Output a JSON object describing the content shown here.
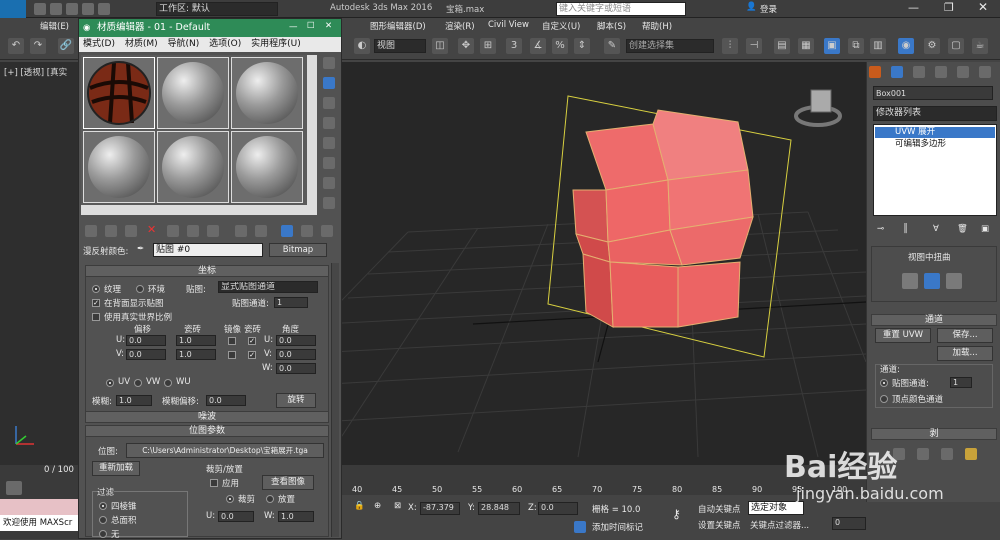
{
  "app": {
    "window_title": "Autodesk 3ds Max 2016",
    "file_name": "宝箱.max",
    "workspace": "工作区: 默认",
    "search_placeholder": "键入关键字或短语",
    "login": "登录",
    "logo_text": "MAX"
  },
  "menubar": {
    "items": [
      "编辑(E)",
      "图形编辑器(D)",
      "渲染(R)",
      "Civil View",
      "自定义(U)",
      "脚本(S)",
      "帮助(H)"
    ]
  },
  "toolbar": {
    "view_combo": "视图",
    "selection_set": "创建选择集",
    "numbers": [
      "3",
      "%"
    ]
  },
  "viewport": {
    "label": "[+] [透视] [真实",
    "timeline": "0 / 100",
    "gizmo_axes": [
      "x",
      "y",
      "z"
    ]
  },
  "material_editor": {
    "title": "材质编辑器 - 01 - Default",
    "menu": [
      "模式(D)",
      "材质(M)",
      "导航(N)",
      "选项(O)",
      "实用程序(U)"
    ],
    "diffuse_label": "漫反射颜色:",
    "map_name": "贴图 #0",
    "map_type": "Bitmap",
    "coords": {
      "header": "坐标",
      "texture": "纹理",
      "environ": "环境",
      "mapping_label": "贴图:",
      "mapping_value": "显式贴图通道",
      "show_back": "在背面显示贴图",
      "channel_label": "贴图通道:",
      "channel_value": "1",
      "real_world": "使用真实世界比例",
      "col_offset": "偏移",
      "col_tiling": "瓷砖",
      "col_mirror": "镜像",
      "col_tile": "瓷砖",
      "col_angle": "角度",
      "u": "U:",
      "v": "V:",
      "w": "W:",
      "u_offset": "0.0",
      "v_offset": "0.0",
      "u_tiling": "1.0",
      "v_tiling": "1.0",
      "u_angle": "0.0",
      "v_angle": "0.0",
      "w_angle": "0.0",
      "uv": "UV",
      "vw": "VW",
      "wu": "WU",
      "blur_label": "模糊:",
      "blur_value": "1.0",
      "blur_offset_label": "模糊偏移:",
      "blur_offset_value": "0.0",
      "rotate": "旋转"
    },
    "noise_header": "噪波",
    "bitmap_params": {
      "header": "位图参数",
      "bitmap_label": "位图:",
      "bitmap_path": "C:\\Users\\Administrator\\Desktop\\宝箱展开.tga",
      "reload": "重新加载",
      "crop_group": "裁剪/放置",
      "apply": "应用",
      "view_image": "查看图像",
      "crop": "裁剪",
      "place": "放置",
      "u_label": "U:",
      "u_value": "0.0",
      "w_label": "W:",
      "w_value": "1.0",
      "filter_group": "过滤",
      "quad": "四棱锥",
      "summed": "总面积",
      "none": "无"
    }
  },
  "command_panel": {
    "object_name": "Box001",
    "modifier_list": "修改器列表",
    "stack": [
      "UVW 展开",
      "可编辑多边形"
    ],
    "peel_header": "视图中扭曲",
    "channel_header": "通道",
    "reset_uvw": "重置 UVW",
    "save": "保存...",
    "load": "加载...",
    "channel_group": "通道:",
    "map_channel_label": "贴图通道:",
    "map_channel_value": "1",
    "vertex_color": "顶点颜色通道",
    "peel_label": "剥"
  },
  "status": {
    "welcome": "欢迎使用 MAXScr",
    "x_label": "X:",
    "x_value": "-87.379",
    "y_label": "Y:",
    "y_value": "28.848",
    "z_label": "Z:",
    "z_value": "0.0",
    "grid": "栅格 = 10.0",
    "auto_key": "自动关键点",
    "selected": "选定对象",
    "set_key": "设置关键点",
    "key_filters": "关键点过滤器...",
    "add_time_tag": "添加时间标记",
    "frame_value": "0",
    "ruler_ticks": [
      "40",
      "45",
      "50",
      "55",
      "60",
      "65",
      "70",
      "75",
      "80",
      "85",
      "90",
      "95",
      "100"
    ]
  },
  "watermark": {
    "text": "Bai经验",
    "sub": "jingyan.baidu.com"
  },
  "colors": {
    "mat_title_bar": "#2e8b57",
    "box_fill": "#e8585a",
    "bbox_line": "#d8d040",
    "selection_blue": "#3a78c8"
  }
}
